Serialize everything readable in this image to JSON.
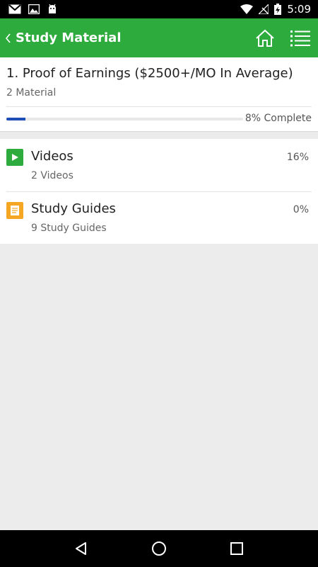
{
  "status_bar": {
    "time": "5:09",
    "left_icons": [
      "gmail-icon",
      "image-icon",
      "android-debug-icon"
    ],
    "right_icons": [
      "wifi-icon",
      "no-signal-icon",
      "battery-charging-icon"
    ]
  },
  "app_bar": {
    "title": "Study Material",
    "background": "#2eab3d",
    "icons": [
      "back-chevron-icon",
      "home-icon",
      "menu-list-icon"
    ]
  },
  "lesson": {
    "title": "1. Proof of Earnings ($2500+/MO In Average)",
    "subtitle": "2 Material",
    "progress_percent": 8,
    "progress_text": "8% Complete",
    "progress_color": "#1e4db7"
  },
  "materials": [
    {
      "title": "Videos",
      "subtitle": "2 Videos",
      "percent": "16%",
      "icon": "video-play-icon",
      "icon_color": "#2eab3d"
    },
    {
      "title": "Study Guides",
      "subtitle": "9 Study Guides",
      "percent": "0%",
      "icon": "document-icon",
      "icon_color": "#f5a623"
    }
  ],
  "nav_bar": {
    "icons": [
      "nav-back-icon",
      "nav-home-icon",
      "nav-recents-icon"
    ]
  }
}
